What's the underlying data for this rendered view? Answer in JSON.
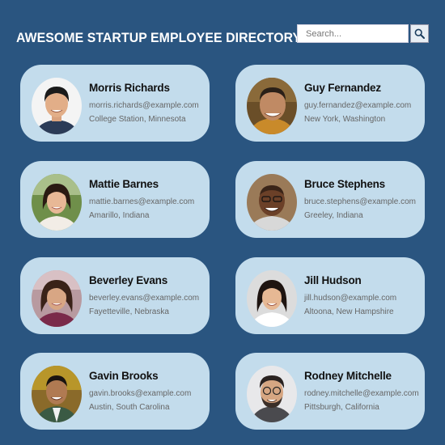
{
  "header": {
    "title": "AWESOME STARTUP EMPLOYEE DIRECTORY",
    "search_placeholder": "Search...",
    "search_icon": "magnifier-icon"
  },
  "employees": [
    {
      "name": "Morris Richards",
      "email": "morris.richards@example.com",
      "location": "College Station, Minnesota"
    },
    {
      "name": "Guy Fernandez",
      "email": "guy.fernandez@example.com",
      "location": "New York, Washington"
    },
    {
      "name": "Mattie Barnes",
      "email": "mattie.barnes@example.com",
      "location": "Amarillo, Indiana"
    },
    {
      "name": "Bruce Stephens",
      "email": "bruce.stephens@example.com",
      "location": "Greeley, Indiana"
    },
    {
      "name": "Beverley Evans",
      "email": "beverley.evans@example.com",
      "location": "Fayetteville, Nebraska"
    },
    {
      "name": "Jill Hudson",
      "email": "jill.hudson@example.com",
      "location": "Altoona, New Hampshire"
    },
    {
      "name": "Gavin Brooks",
      "email": "gavin.brooks@example.com",
      "location": "Austin, South Carolina"
    },
    {
      "name": "Rodney Mitchelle",
      "email": "rodney.mitchelle@example.com",
      "location": "Pittsburgh, California"
    }
  ],
  "colors": {
    "background": "#2a5580",
    "card": "#c3dcec"
  }
}
